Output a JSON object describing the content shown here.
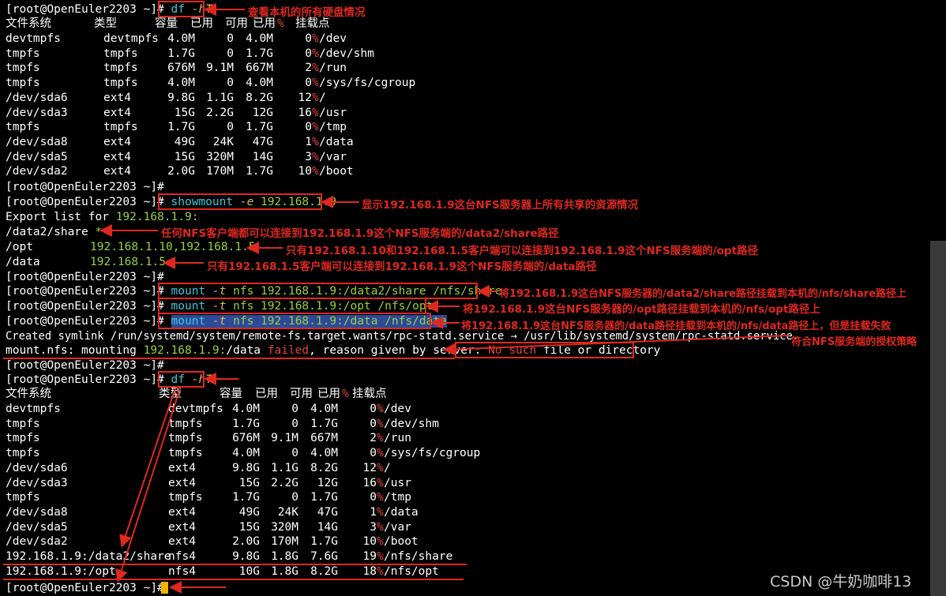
{
  "prompt": "[root@OpenEuler2203 ~]#",
  "cmd1": {
    "name": "df",
    "args": "-hT"
  },
  "df_header": {
    "fs": "文件系统",
    "type": "类型",
    "size": "容量",
    "used": "已用",
    "avail": "可用",
    "usep_a": "已用",
    "usep_b": "%",
    "mount": "挂载点"
  },
  "df1": [
    [
      "devtmpfs",
      "devtmpfs",
      "4.0M",
      "0",
      "4.0M",
      "0",
      "/dev"
    ],
    [
      "tmpfs",
      "tmpfs",
      "1.7G",
      "0",
      "1.7G",
      "0",
      "/dev/shm"
    ],
    [
      "tmpfs",
      "tmpfs",
      "676M",
      "9.1M",
      "667M",
      "2",
      "/run"
    ],
    [
      "tmpfs",
      "tmpfs",
      "4.0M",
      "0",
      "4.0M",
      "0",
      "/sys/fs/cgroup"
    ],
    [
      "/dev/sda6",
      "ext4",
      "9.8G",
      "1.1G",
      "8.2G",
      "12",
      "/"
    ],
    [
      "/dev/sda3",
      "ext4",
      "15G",
      "2.2G",
      "12G",
      "16",
      "/usr"
    ],
    [
      "tmpfs",
      "tmpfs",
      "1.7G",
      "0",
      "1.7G",
      "0",
      "/tmp"
    ],
    [
      "/dev/sda8",
      "ext4",
      "49G",
      "24K",
      "47G",
      "1",
      "/data"
    ],
    [
      "/dev/sda5",
      "ext4",
      "15G",
      "320M",
      "14G",
      "3",
      "/var"
    ],
    [
      "/dev/sda2",
      "ext4",
      "2.0G",
      "170M",
      "1.7G",
      "10",
      "/boot"
    ]
  ],
  "pct": "%",
  "cmd2": {
    "name": "showmount",
    "opt": "-e",
    "arg": "192.168.1.9"
  },
  "export_label": "Export list for",
  "export_host": "192.168.1.9:",
  "exports": [
    {
      "path": "/data2/share",
      "clients": "*"
    },
    {
      "path": "/opt",
      "clients": "192.168.1.10,192.168.1.5"
    },
    {
      "path": "/data",
      "clients": "192.168.1.5"
    }
  ],
  "mounts": [
    {
      "cmd": "mount",
      "opt": "-t",
      "rest": "nfs 192.168.1.9:/data2/share /nfs/share"
    },
    {
      "cmd": "mount",
      "opt": "-t",
      "rest": "nfs 192.168.1.9:/opt /nfs/opt"
    },
    {
      "cmd": "mount",
      "opt": "-t",
      "rest": "nfs 192.168.1.9:/data /nfs/data"
    }
  ],
  "symlink_line": "Created symlink /run/systemd/system/remote-fs.target.wants/rpc-statd.service → /usr/lib/systemd/system/rpc-statd.service.",
  "err": {
    "prefix": "mount.nfs: mounting",
    "host": "192.168.1.9:",
    "path": "/data",
    "failed": "failed",
    "reason": ", reason given by server:",
    "no_such": "No such",
    "tail": "file or directory"
  },
  "df2": [
    [
      "devtmpfs",
      "devtmpfs",
      "4.0M",
      "0",
      "4.0M",
      "0",
      "/dev"
    ],
    [
      "tmpfs",
      "tmpfs",
      "1.7G",
      "0",
      "1.7G",
      "0",
      "/dev/shm"
    ],
    [
      "tmpfs",
      "tmpfs",
      "676M",
      "9.1M",
      "667M",
      "2",
      "/run"
    ],
    [
      "tmpfs",
      "tmpfs",
      "4.0M",
      "0",
      "4.0M",
      "0",
      "/sys/fs/cgroup"
    ],
    [
      "/dev/sda6",
      "ext4",
      "9.8G",
      "1.1G",
      "8.2G",
      "12",
      "/"
    ],
    [
      "/dev/sda3",
      "ext4",
      "15G",
      "2.2G",
      "12G",
      "16",
      "/usr"
    ],
    [
      "tmpfs",
      "tmpfs",
      "1.7G",
      "0",
      "1.7G",
      "0",
      "/tmp"
    ],
    [
      "/dev/sda8",
      "ext4",
      "49G",
      "24K",
      "47G",
      "1",
      "/data"
    ],
    [
      "/dev/sda5",
      "ext4",
      "15G",
      "320M",
      "14G",
      "3",
      "/var"
    ],
    [
      "/dev/sda2",
      "ext4",
      "2.0G",
      "170M",
      "1.7G",
      "10",
      "/boot"
    ],
    [
      "192.168.1.9:/data2/share",
      "nfs4",
      "9.8G",
      "1.8G",
      "7.6G",
      "19",
      "/nfs/share"
    ],
    [
      "192.168.1.9:/opt",
      "nfs4",
      "10G",
      "1.8G",
      "8.2G",
      "18",
      "/nfs/opt"
    ]
  ],
  "annotations": {
    "a1": "查看本机的所有硬盘情况",
    "a2": "显示192.168.1.9这台NFS服务器上所有共享的资源情况",
    "a3": "任何NFS客户端都可以连接到192.168.1.9这个NFS服务端的/data2/share路径",
    "a4": "只有192.168.1.10和192.168.1.5客户端可以连接到192.168.1.9这个NFS服务端的/opt路径",
    "a5": "只有192.168.1.5客户端可以连接到192.168.1.9这个NFS服务端的/data路径",
    "a6": "将192.168.1.9这台NFS服务器的/data2/share路径挂载到本机的/nfs/share路径上",
    "a7": "将192.168.1.9这台NFS服务器的/opt路径挂载到本机的/nfs/opt路径上",
    "a8": "将192.168.1.9这台NFS服务器的/data路径挂载到本机的/nfs/data路径上，但是挂载失败",
    "a9": "符合NFS服务端的授权策略"
  },
  "watermark": "CSDN @牛奶咖啡13",
  "colors": {
    "annotation": "#e0281f",
    "cyan": "#3ec6d6",
    "green": "#9bcf3e",
    "red_text": "#e0433b"
  }
}
